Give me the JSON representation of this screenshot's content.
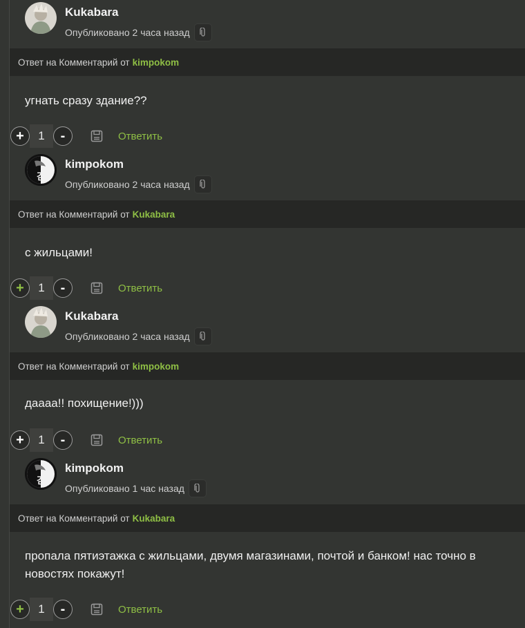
{
  "reply_prefix": "Ответ на Комментарий от",
  "reply_label": "Ответить",
  "comments": [
    {
      "author": "Kukabara",
      "published": "Опубликовано 2 часа назад",
      "reply_to": "kimpokom",
      "text": "угнать сразу здание??",
      "score": "1",
      "plus_active": false
    },
    {
      "author": "kimpokom",
      "published": "Опубликовано 2 часа назад",
      "reply_to": "Kukabara",
      "text": "с жильцами!",
      "score": "1",
      "plus_active": true
    },
    {
      "author": "Kukabara",
      "published": "Опубликовано 2 часа назад",
      "reply_to": "kimpokom",
      "text": "даааа!! похищение!)))",
      "score": "1",
      "plus_active": false
    },
    {
      "author": "kimpokom",
      "published": "Опубликовано 1 час назад",
      "reply_to": "Kukabara",
      "text": "пропала пятиэтажка с жильцами, двумя магазинами, почтой и банком! нас точно в новостях покажут!",
      "score": "1",
      "plus_active": true
    }
  ],
  "icons": {
    "attachment": "paperclip-icon",
    "save": "floppy-disk-icon"
  },
  "colors": {
    "accent": "#8fbf45",
    "background": "#333532",
    "reply_bar": "#262725"
  }
}
